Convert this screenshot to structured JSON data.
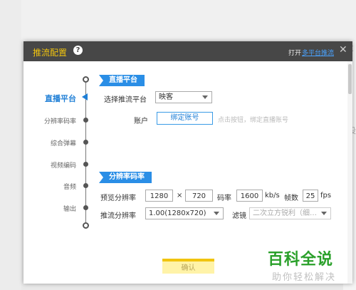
{
  "background": {
    "glyph_x": "X",
    "glyph_mid": "设"
  },
  "dialog": {
    "title": "推流配置",
    "help_icon": "?",
    "open_text": "打开",
    "open_link": "多平台推流",
    "close_icon": "✕"
  },
  "nav": {
    "items": [
      "直播平台",
      "分辨率码率",
      "综合弹幕",
      "视频编码",
      "音频",
      "输出"
    ],
    "active": "直播平台"
  },
  "platform_section": {
    "badge": "直播平台",
    "select_label": "选择推流平台",
    "select_value": "映客",
    "account_label": "账户",
    "bind_button": "绑定账号",
    "hint": "点击按钮，绑定直播账号"
  },
  "resolution_section": {
    "badge": "分辨率码率",
    "preview_label": "预览分辨率",
    "preview_width": "1280",
    "times": "×",
    "preview_height": "720",
    "bitrate_label": "码率",
    "bitrate_value": "1600",
    "bitrate_unit": "kb/s",
    "fps_label": "帧数",
    "fps_value": "25",
    "fps_unit": "fps",
    "push_label": "推流分辨率",
    "push_value": "1.00(1280x720)",
    "filter_label": "滤镜",
    "filter_value": "二次立方锐利（细…"
  },
  "confirm_button": "确认",
  "watermark": {
    "title": "百科全说",
    "subtitle": "助你轻松解决"
  }
}
